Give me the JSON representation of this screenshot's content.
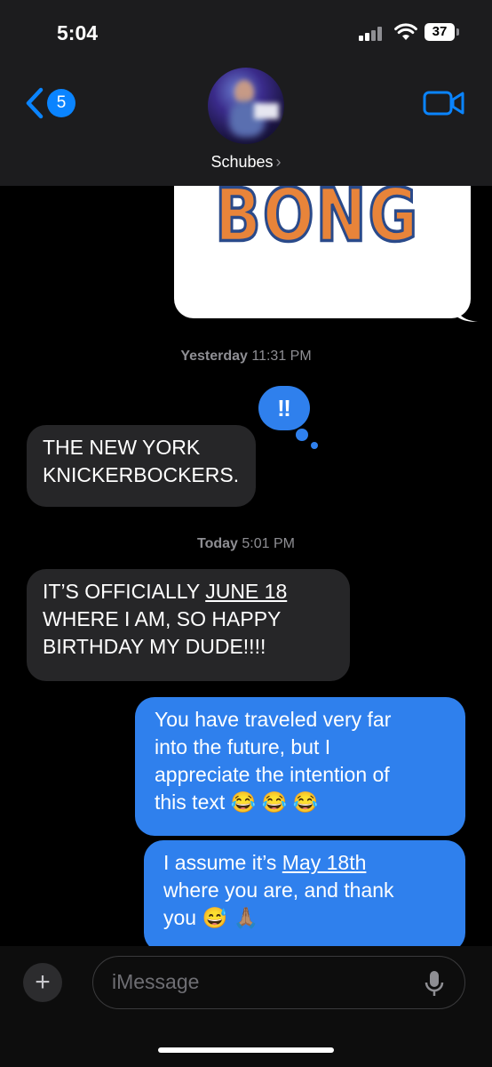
{
  "status_bar": {
    "time": "5:04",
    "battery": "37"
  },
  "header": {
    "back_count": "5",
    "contact_name": "Schubes",
    "chevron": "›"
  },
  "image_text": "BONG",
  "timestamps": [
    {
      "day": "Yesterday",
      "time": "11:31 PM"
    },
    {
      "day": "Today",
      "time": "5:01 PM"
    }
  ],
  "tapback": "‼",
  "messages": {
    "m1": {
      "line1": "THE NEW YORK",
      "line2": "KNICKERBOCKERS."
    },
    "m2": {
      "l1_pre": "IT’S OFFICIALLY ",
      "l1_link": "JUNE 18",
      "line2": "WHERE I AM, SO HAPPY",
      "line3": "BIRTHDAY MY DUDE!!!!"
    },
    "m3": {
      "line1": "You have traveled very far",
      "line2": "into the future, but I",
      "line3": "appreciate the intention of",
      "line4": "this text 😂 😂 😂"
    },
    "m4": {
      "l1_pre": "I assume it’s ",
      "l1_link": "May 18th",
      "line2": "where you are, and thank",
      "line3": "you 😅 🙏🏽"
    }
  },
  "composer": {
    "placeholder": "iMessage",
    "plus": "+"
  }
}
